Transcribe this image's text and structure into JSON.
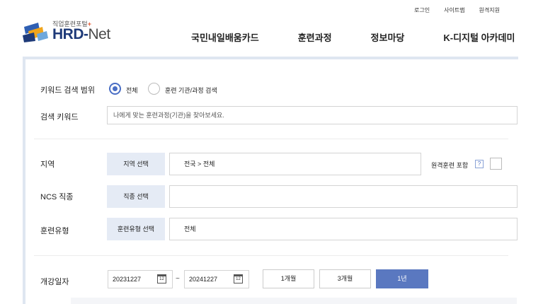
{
  "header": {
    "util_links": [
      "로그인",
      "사이트맵",
      "원격지원"
    ],
    "logo_sub": "직업훈련포털",
    "logo_plus": "+",
    "logo_main_a": "HRD-",
    "logo_main_b": "Net",
    "nav": [
      "국민내일배움카드",
      "훈련과정",
      "정보마당",
      "K-디지털 아카데미"
    ]
  },
  "search": {
    "scope_label": "키워드 검색 범위",
    "scope_options": [
      {
        "label": "전체",
        "selected": true
      },
      {
        "label": "훈련 기관/과정 검색",
        "selected": false
      }
    ],
    "keyword_label": "검색 키워드",
    "keyword_placeholder": "나에게 맞는 훈련과정(기관)을 찾아보세요.",
    "region_label": "지역",
    "region_button": "지역 선택",
    "region_value": "전국 > 전체",
    "remote_label": "원격훈련 포함",
    "remote_help": "?",
    "ncs_label": "NCS 직종",
    "ncs_button": "직종 선택",
    "ncs_value": "",
    "type_label": "훈련유형",
    "type_button": "훈련유형 선택",
    "type_value": "전체",
    "date_label": "개강일자",
    "date_from": "20231227",
    "date_to": "20241227",
    "date_sep": "~",
    "calendar_glyph": "12",
    "periods": [
      {
        "label": "1개월",
        "selected": false
      },
      {
        "label": "3개월",
        "selected": false
      },
      {
        "label": "1년",
        "selected": true
      }
    ]
  },
  "colors": {
    "accent": "#4a6ec5",
    "panel_border": "#dfe6f1",
    "button_bg": "#e5ebf5",
    "active_period": "#5a78c0"
  }
}
